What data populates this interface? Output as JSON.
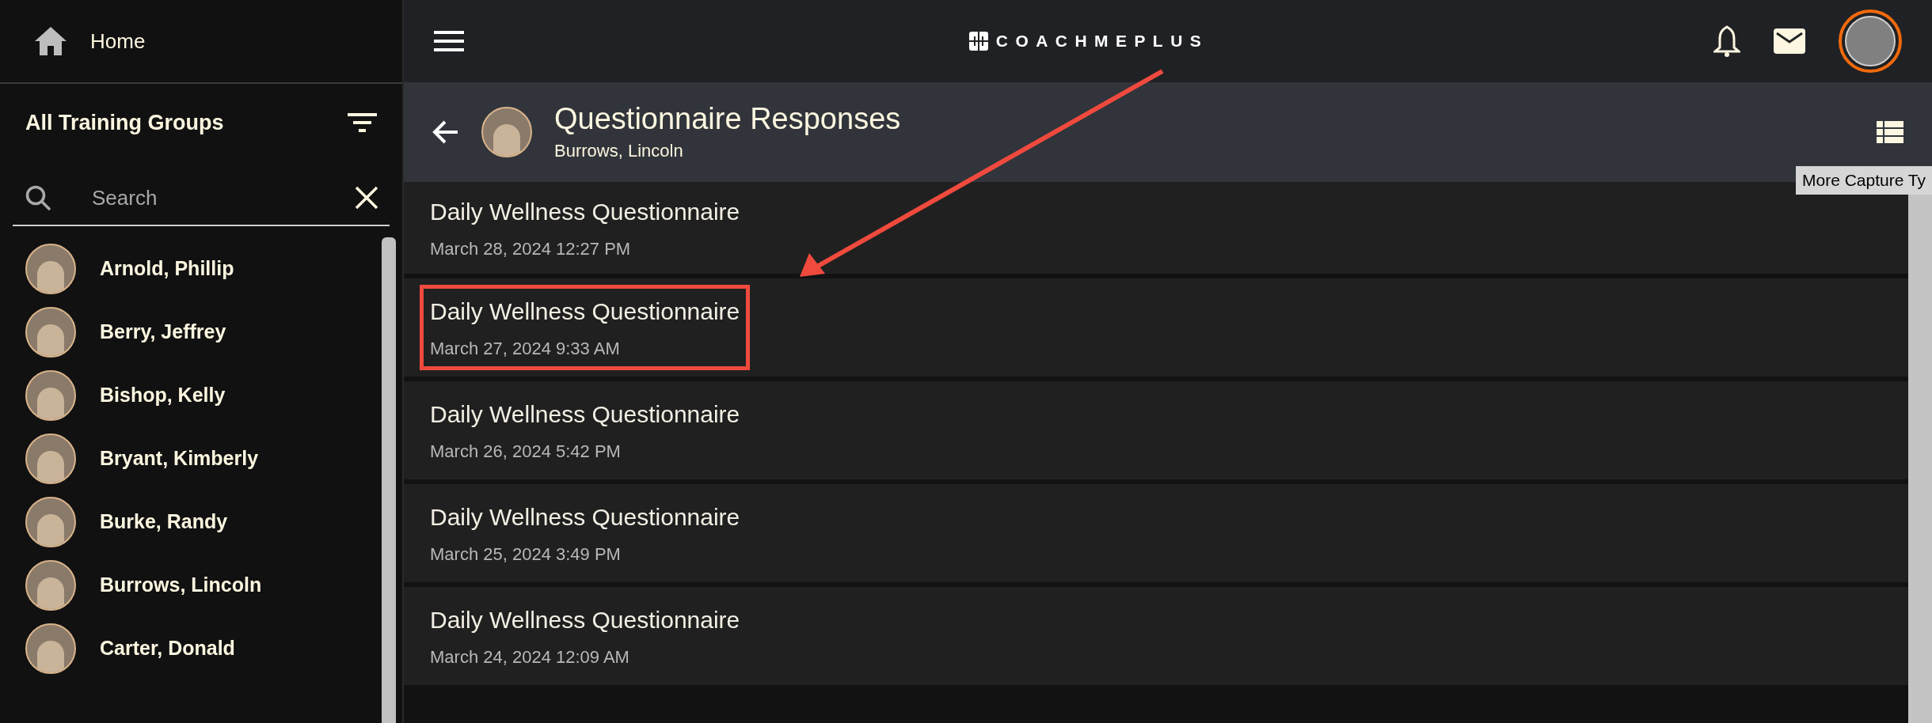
{
  "sidebar": {
    "home": {
      "label": "Home"
    },
    "group_title": "All Training Groups",
    "search": {
      "placeholder": "Search"
    },
    "athletes": [
      {
        "name": "Arnold, Phillip",
        "selected": false
      },
      {
        "name": "Berry, Jeffrey",
        "selected": false
      },
      {
        "name": "Bishop, Kelly",
        "selected": false
      },
      {
        "name": "Bryant, Kimberly",
        "selected": false
      },
      {
        "name": "Burke, Randy",
        "selected": false
      },
      {
        "name": "Burrows, Lincoln",
        "selected": false
      },
      {
        "name": "Carter, Donald",
        "selected": false
      }
    ]
  },
  "top_bar": {
    "logo": "COACHMEPLUS"
  },
  "header": {
    "title": "Questionnaire Responses",
    "athlete": "Burrows, Lincoln",
    "tooltip": "More Capture Ty"
  },
  "responses": [
    {
      "title": "Daily Wellness Questionnaire",
      "date": "March 28, 2024 12:27 PM",
      "highlighted": false
    },
    {
      "title": "Daily Wellness Questionnaire",
      "date": "March 27, 2024 9:33 AM",
      "highlighted": true
    },
    {
      "title": "Daily Wellness Questionnaire",
      "date": "March 26, 2024 5:42 PM",
      "highlighted": false
    },
    {
      "title": "Daily Wellness Questionnaire",
      "date": "March 25, 2024 3:49 PM",
      "highlighted": false
    },
    {
      "title": "Daily Wellness Questionnaire",
      "date": "March 24, 2024 12:09 AM",
      "highlighted": false
    }
  ]
}
